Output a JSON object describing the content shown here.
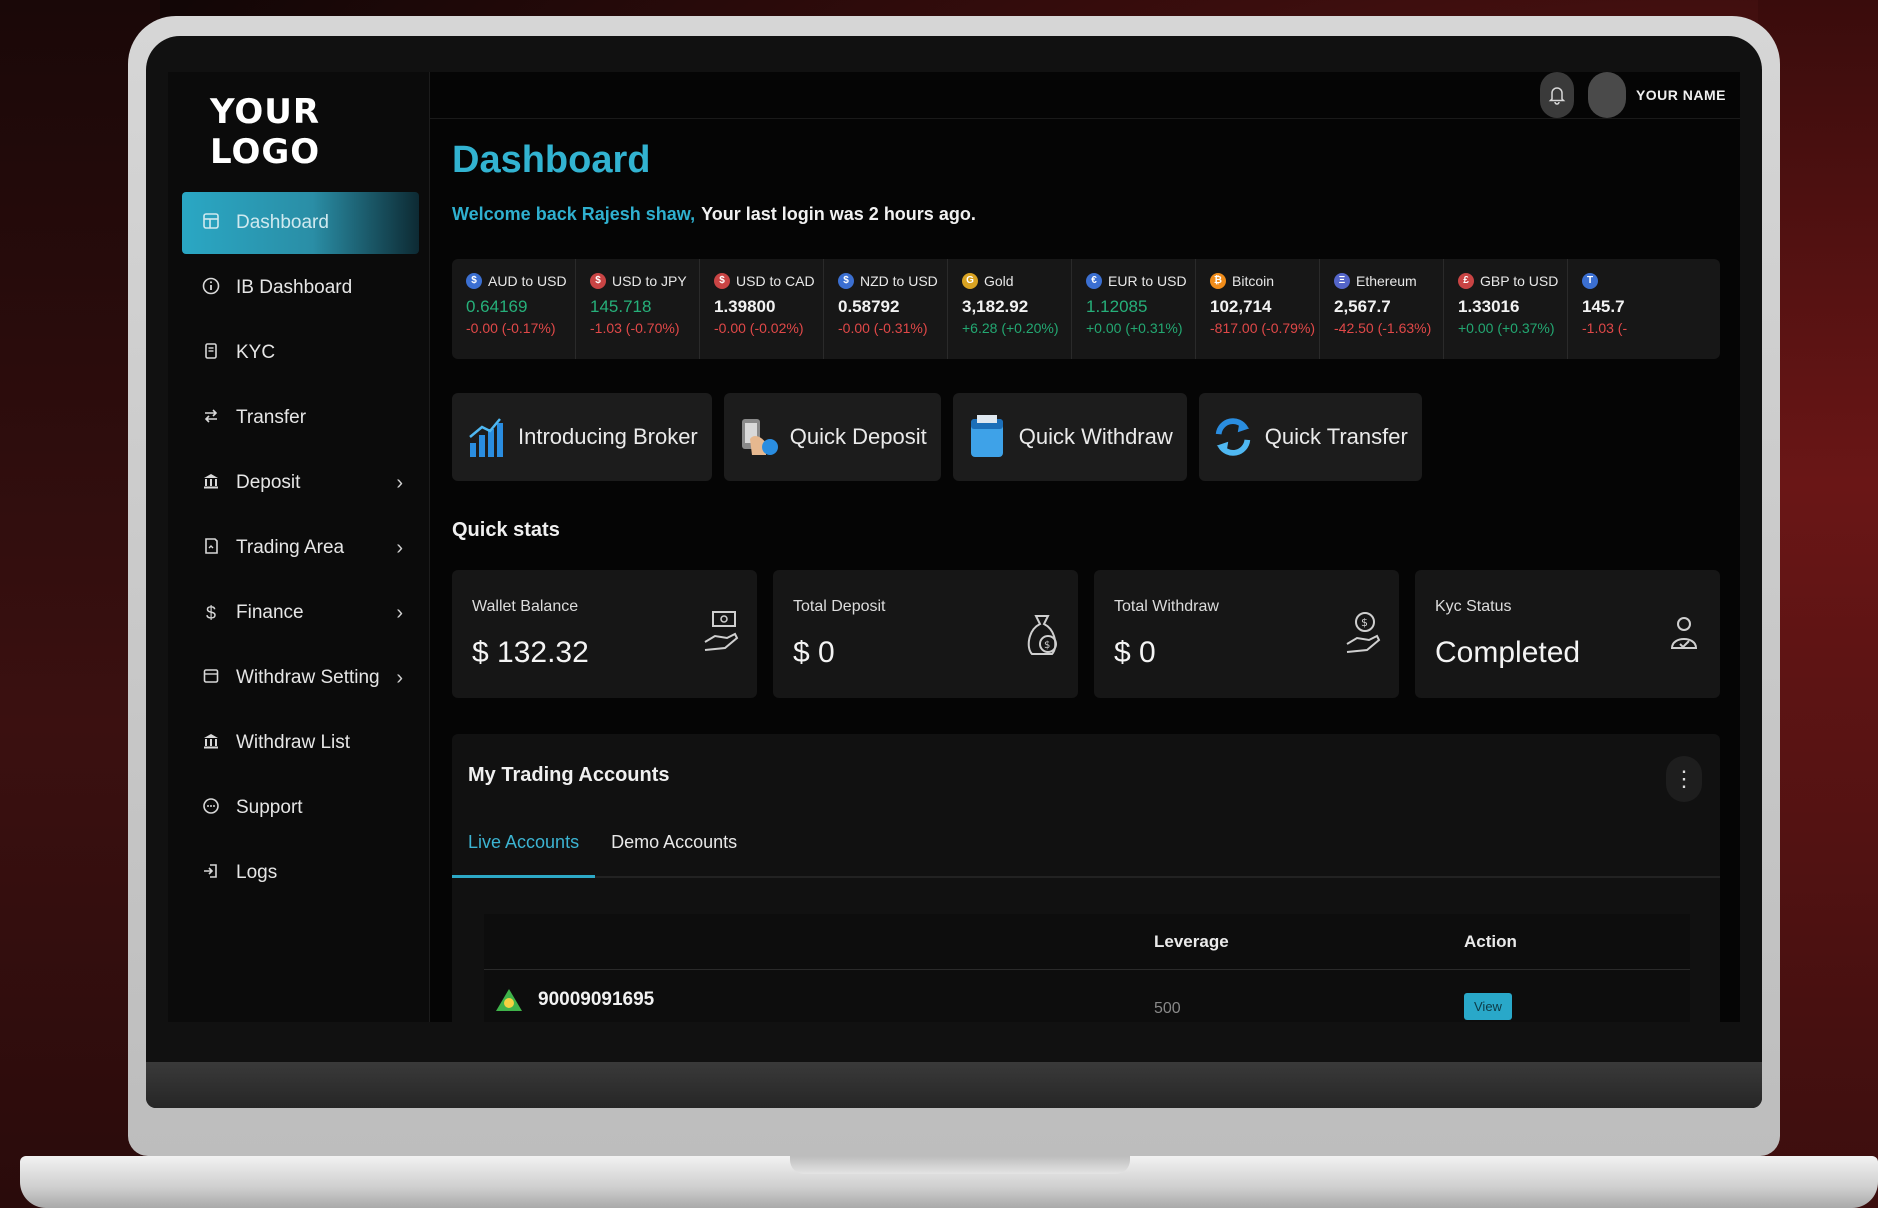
{
  "brand": {
    "logo": "YOUR LOGO"
  },
  "header": {
    "username": "YOUR NAME"
  },
  "sidebar": {
    "items": [
      {
        "label": "Dashboard",
        "icon": "dashboard-icon",
        "active": true
      },
      {
        "label": "IB Dashboard",
        "icon": "info-icon"
      },
      {
        "label": "KYC",
        "icon": "id-card-icon"
      },
      {
        "label": "Transfer",
        "icon": "transfer-icon"
      },
      {
        "label": "Deposit",
        "icon": "bank-icon",
        "has_submenu": true
      },
      {
        "label": "Trading Area",
        "icon": "chart-icon",
        "has_submenu": true
      },
      {
        "label": "Finance",
        "icon": "dollar-icon",
        "has_submenu": true
      },
      {
        "label": "Withdraw Setting",
        "icon": "wallet-icon",
        "has_submenu": true
      },
      {
        "label": "Withdraw List",
        "icon": "bank-icon"
      },
      {
        "label": "Support",
        "icon": "chat-icon"
      },
      {
        "label": "Logs",
        "icon": "logout-icon"
      }
    ]
  },
  "page": {
    "title": "Dashboard",
    "welcome_name": "Welcome back Rajesh shaw,",
    "welcome_rest": "Your last login was 2 hours ago."
  },
  "ticker": [
    {
      "name": "AUD to USD",
      "price": "0.64169",
      "change": "-0.00 (-0.17%)",
      "up": false,
      "price_green": true
    },
    {
      "name": "USD to JPY",
      "price": "145.718",
      "change": "-1.03 (-0.70%)",
      "up": false,
      "price_green": true
    },
    {
      "name": "USD to CAD",
      "price": "1.39800",
      "change": "-0.00 (-0.02%)",
      "up": false
    },
    {
      "name": "NZD to USD",
      "price": "0.58792",
      "change": "-0.00 (-0.31%)",
      "up": false
    },
    {
      "name": "Gold",
      "price": "3,182.92",
      "change": "+6.28 (+0.20%)",
      "up": true
    },
    {
      "name": "EUR to USD",
      "price": "1.12085",
      "change": "+0.00 (+0.31%)",
      "up": true,
      "price_green": true
    },
    {
      "name": "Bitcoin",
      "price": "102,714",
      "change": "-817.00 (-0.79%)",
      "up": false
    },
    {
      "name": "Ethereum",
      "price": "2,567.7",
      "change": "-42.50 (-1.63%)",
      "up": false
    },
    {
      "name": "GBP to USD",
      "price": "1.33016",
      "change": "+0.00 (+0.37%)",
      "up": true
    },
    {
      "name": "",
      "price": "145.7",
      "change": "-1.03 (-",
      "up": false
    }
  ],
  "quick_actions": [
    {
      "label": "Introducing Broker",
      "icon": "broker-chart-icon"
    },
    {
      "label": "Quick Deposit",
      "icon": "deposit-icon"
    },
    {
      "label": "Quick Withdraw",
      "icon": "withdraw-icon"
    },
    {
      "label": "Quick Transfer",
      "icon": "transfer-arrows-icon"
    }
  ],
  "quick_stats": {
    "title": "Quick stats",
    "cards": [
      {
        "label": "Wallet Balance",
        "value": "$ 132.32",
        "icon": "wallet-hand-icon"
      },
      {
        "label": "Total Deposit",
        "value": "$ 0",
        "icon": "money-bag-icon"
      },
      {
        "label": "Total Withdraw",
        "value": "$ 0",
        "icon": "cash-hand-icon"
      },
      {
        "label": "Kyc Status",
        "value": "Completed",
        "icon": "verified-user-icon"
      }
    ]
  },
  "trading_accounts": {
    "title": "My Trading Accounts",
    "tabs": [
      {
        "label": "Live Accounts",
        "active": true
      },
      {
        "label": "Demo Accounts"
      }
    ],
    "columns": {
      "leverage": "Leverage",
      "action": "Action"
    },
    "rows": [
      {
        "account": "90009091695",
        "leverage": "500",
        "action": "View"
      }
    ]
  },
  "colors": {
    "accent": "#2fb0cf",
    "positive": "#23a872",
    "negative": "#e04848"
  }
}
